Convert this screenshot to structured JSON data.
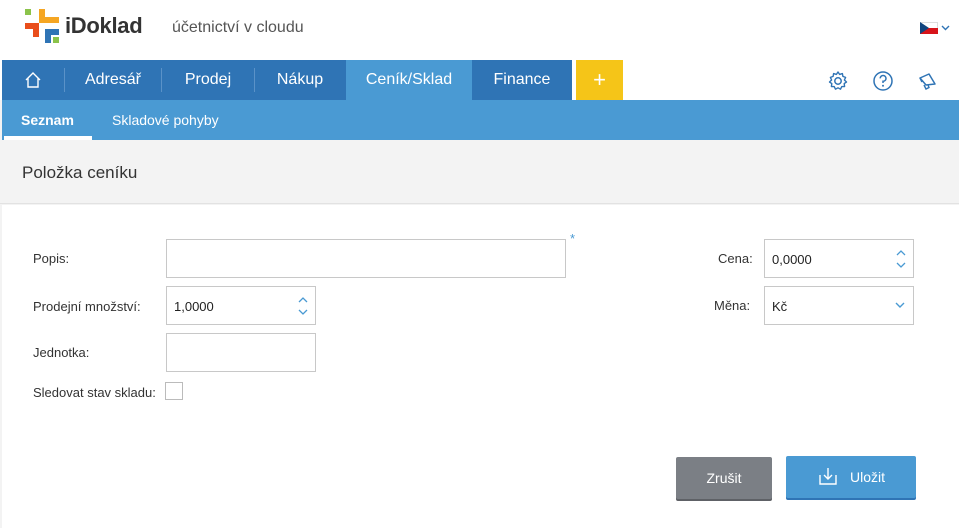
{
  "app": {
    "brand": "iDoklad",
    "tagline": "účetnictví v cloudu",
    "language_icon": "czech-flag-icon"
  },
  "main_nav": {
    "home_icon": "home-icon",
    "items": [
      {
        "label": "Adresář",
        "active": false
      },
      {
        "label": "Prodej",
        "active": false
      },
      {
        "label": "Nákup",
        "active": false
      },
      {
        "label": "Ceník/Sklad",
        "active": true
      },
      {
        "label": "Finance",
        "active": false
      }
    ],
    "add_label": "+",
    "tools": [
      "gear-icon",
      "help-icon",
      "megaphone-icon"
    ]
  },
  "sub_nav": {
    "items": [
      {
        "label": "Seznam",
        "active": true
      },
      {
        "label": "Skladové pohyby",
        "active": false
      }
    ]
  },
  "page": {
    "title": "Položka ceníku"
  },
  "form": {
    "popis": {
      "label": "Popis:",
      "value": "",
      "required_mark": "*"
    },
    "prodejni_mnozstvi": {
      "label": "Prodejní množství:",
      "value": "1,0000"
    },
    "jednotka": {
      "label": "Jednotka:",
      "value": ""
    },
    "sledovat_stav_skladu": {
      "label": "Sledovat stav skladu:",
      "checked": false
    },
    "cena": {
      "label": "Cena:",
      "value": "0,0000"
    },
    "mena": {
      "label": "Měna:",
      "value": "Kč"
    }
  },
  "actions": {
    "cancel_label": "Zrušit",
    "save_label": "Uložit"
  },
  "colors": {
    "nav_blue": "#2f74b5",
    "active_blue": "#4a9ad3",
    "plus_yellow": "#f5c518",
    "cancel_gray": "#7b7f85"
  }
}
